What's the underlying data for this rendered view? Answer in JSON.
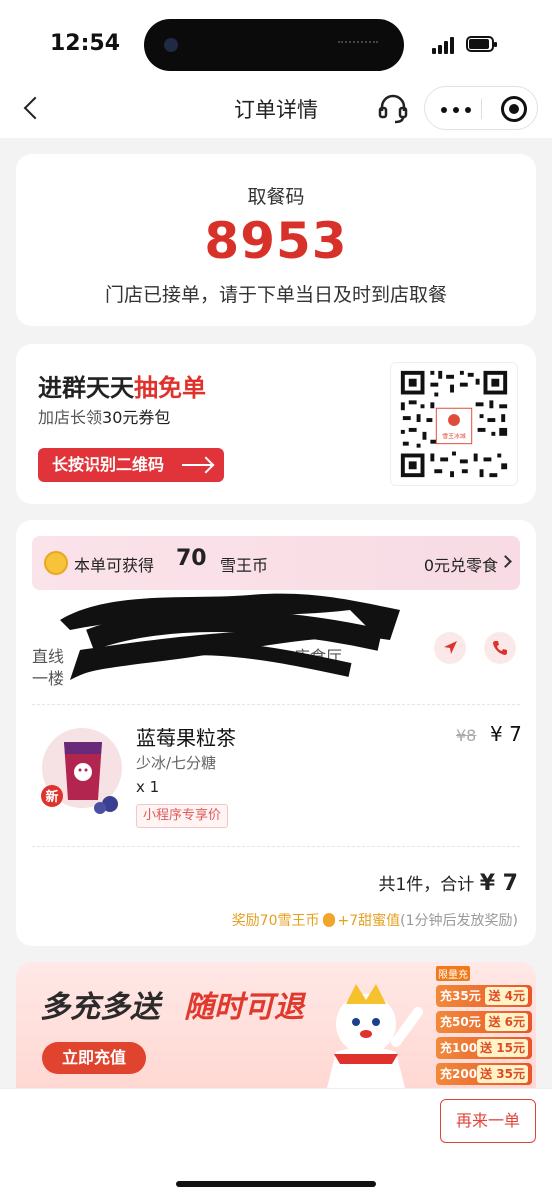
{
  "status_bar": {
    "time": "12:54"
  },
  "nav": {
    "title": "订单详情"
  },
  "pickup": {
    "label": "取餐码",
    "code": "8953",
    "note": "门店已接单，请于下单当日及时到店取餐"
  },
  "group": {
    "title_prefix": "进群天天",
    "title_highlight": "抽免单",
    "subtitle_prefix": "加店长领",
    "subtitle_amount": "30元券包",
    "button_label": "长按识别二维码",
    "qr_center_text": "雪王冰城"
  },
  "coins": {
    "text": "本单可获得",
    "amount": "70",
    "unit": "雪王币",
    "link_label": "0元兑零食"
  },
  "store": {
    "addr_line1": "直线",
    "addr_line1_tail": "店食厅",
    "addr_line2": "一楼"
  },
  "product": {
    "name": "蓝莓果粒茶",
    "spec": "少冰/七分糖",
    "qty": "x 1",
    "tag": "小程序专享价",
    "price_old": "¥8",
    "price_now": "¥ 7",
    "new_badge": "新"
  },
  "total": {
    "count_text": "共1件，合计",
    "amount": "¥ 7"
  },
  "reward": {
    "coins": "奖励70雪王币",
    "honey": "+7甜蜜值",
    "note": "(1分钟后发放奖励)"
  },
  "banner": {
    "title1": "多充多送",
    "title2": "随时可退",
    "button_label": "立即充值",
    "table_head": "限量充",
    "rows": [
      {
        "charge": "充35元",
        "gift": "送 4元"
      },
      {
        "charge": "充50元",
        "gift": "送 6元"
      },
      {
        "charge": "充100元",
        "gift": "送 15元"
      },
      {
        "charge": "充200元",
        "gift": "送 35元"
      }
    ]
  },
  "bottom": {
    "again_label": "再来一单"
  },
  "colors": {
    "accent": "#e0322c",
    "coin_bar": "#fbe3ea",
    "price_tag": "#e05a5a"
  }
}
